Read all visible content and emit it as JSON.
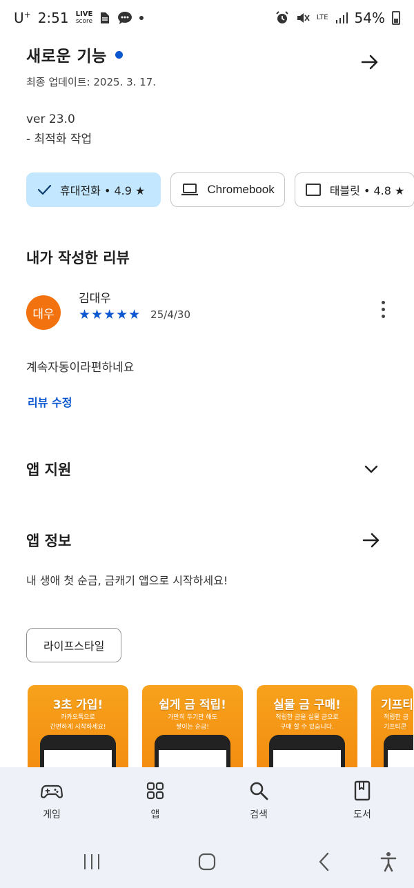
{
  "status_bar": {
    "carrier": "U",
    "carrier_sup": "+",
    "time": "2:51",
    "live_line1": "LIVE",
    "live_line2": "score",
    "lte_label": "LTE",
    "battery": "54%"
  },
  "whats_new": {
    "title": "새로운 기능",
    "updated": "최종 업데이트: 2025. 3. 17.",
    "version": "ver 23.0",
    "note": "- 최적화 작업"
  },
  "device_chips": [
    {
      "label": "휴대전화 • 4.9 ★",
      "icon": "check-icon",
      "selected": true
    },
    {
      "label": "Chromebook",
      "icon": "laptop-icon",
      "selected": false
    },
    {
      "label": "태블릿 • 4.8 ★",
      "icon": "tablet-icon",
      "selected": false
    }
  ],
  "my_review": {
    "title": "내가 작성한 리뷰",
    "avatar_text": "대우",
    "avatar_color": "#f1720f",
    "reviewer": "김대우",
    "stars": "★★★★★",
    "rating": 5,
    "date": "25/4/30",
    "text": "계속자동이라편하네요",
    "edit_label": "리뷰 수정"
  },
  "app_support": {
    "title": "앱 지원"
  },
  "app_info": {
    "title": "앱 정보",
    "description": "내 생애 첫 순금, 금캐기 앱으로 시작하세요!",
    "category": "라이프스타일"
  },
  "screenshots": [
    {
      "title": "3초 가입!",
      "subtitle": "카카오톡으로\n간편하게 시작하세요!"
    },
    {
      "title": "쉽게 금 적립!",
      "subtitle": "가만히 두기만 해도\n쌓이는 순금!"
    },
    {
      "title": "실물 금 구매!",
      "subtitle": "적립한 금을 실물 금으로\n구매 할 수 있습니다."
    },
    {
      "title": "기프티",
      "subtitle": "적립한 금\n기프티콘"
    }
  ],
  "bottom_nav": [
    {
      "label": "게임",
      "icon": "gamepad-icon"
    },
    {
      "label": "앱",
      "icon": "apps-grid-icon"
    },
    {
      "label": "검색",
      "icon": "search-icon"
    },
    {
      "label": "도서",
      "icon": "book-icon"
    }
  ],
  "colors": {
    "accent": "#0b57d0",
    "chip_selected": "#c2e7ff",
    "nav_background": "#eef1f8"
  }
}
